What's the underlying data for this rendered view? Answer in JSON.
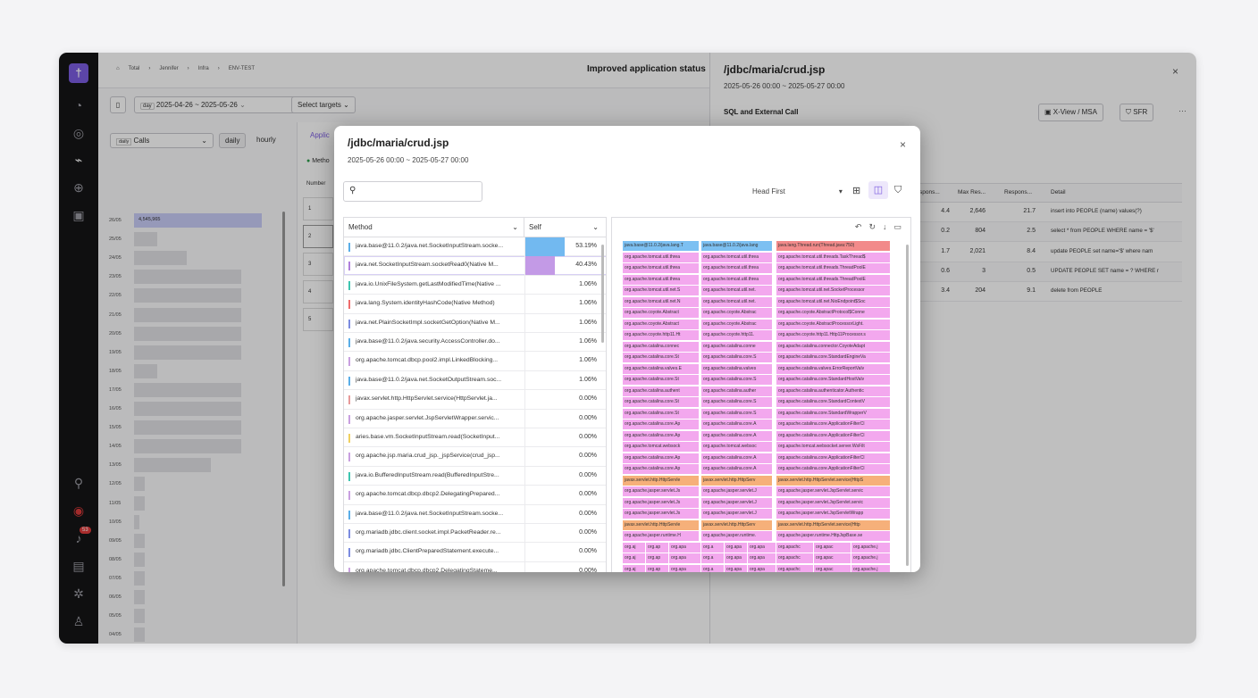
{
  "breadcrumb": [
    "Total",
    "Jennifer",
    "Infra",
    "ENV-TEST"
  ],
  "status_title": "Improved application status",
  "date_range": "2025-04-26 ~ 2025-05-26",
  "date_chip": "day",
  "select_targets": "Select targets",
  "calls_select": "Calls",
  "daily_label": "daily",
  "daily_btn": "daily",
  "hourly_btn": "hourly",
  "center_tab": "Applic",
  "center_method": "Metho",
  "center_number": "Number",
  "center_rows": [
    "1",
    "2",
    "3",
    "4",
    "5"
  ],
  "left_rows": [
    {
      "date": "26/05",
      "value": "4,545,965",
      "bar": 0.95
    },
    {
      "date": "25/05",
      "value": "",
      "bar": 0.17
    },
    {
      "date": "24/05",
      "value": "",
      "bar": 0.39
    },
    {
      "date": "23/05",
      "value": "",
      "bar": 0.8
    },
    {
      "date": "22/05",
      "value": "",
      "bar": 0.8
    },
    {
      "date": "21/05",
      "value": "",
      "bar": 0.8
    },
    {
      "date": "20/05",
      "value": "",
      "bar": 0.8
    },
    {
      "date": "19/05",
      "value": "",
      "bar": 0.8
    },
    {
      "date": "18/05",
      "value": "",
      "bar": 0.17
    },
    {
      "date": "17/05",
      "value": "",
      "bar": 0.8
    },
    {
      "date": "16/05",
      "value": "",
      "bar": 0.8
    },
    {
      "date": "15/05",
      "value": "",
      "bar": 0.8
    },
    {
      "date": "14/05",
      "value": "",
      "bar": 0.8
    },
    {
      "date": "13/05",
      "value": "",
      "bar": 0.57
    },
    {
      "date": "12/05",
      "value": "",
      "bar": 0.08
    },
    {
      "date": "11/05",
      "value": "",
      "bar": 0.08
    },
    {
      "date": "10/05",
      "value": "",
      "bar": 0.04
    },
    {
      "date": "09/05",
      "value": "",
      "bar": 0.08
    },
    {
      "date": "08/05",
      "value": "",
      "bar": 0.08
    },
    {
      "date": "07/05",
      "value": "",
      "bar": 0.08
    },
    {
      "date": "06/05",
      "value": "",
      "bar": 0.08
    },
    {
      "date": "05/05",
      "value": "",
      "bar": 0.08
    },
    {
      "date": "04/05",
      "value": "",
      "bar": 0.08
    }
  ],
  "right": {
    "title": "/jdbc/maria/crud.jsp",
    "subtitle": "2025-05-26 00:00 ~ 2025-05-27 00:00",
    "section": "SQL and External Call",
    "xview_btn": "X-View / MSA",
    "sfr_btn": "SFR",
    "more": "···",
    "close": "×",
    "headers": [
      "spons...",
      "Max Res...",
      "Respons...",
      "Detail"
    ],
    "rows": [
      [
        "4.4",
        "2,646",
        "21.7",
        "insert into PEOPLE (name) values(?)"
      ],
      [
        "0.2",
        "804",
        "2.5",
        "select * from PEOPLE WHERE name = '$'"
      ],
      [
        "1.7",
        "2,021",
        "8.4",
        "update PEOPLE set name='$' where nam"
      ],
      [
        "0.6",
        "3",
        "0.5",
        "UPDATE PEOPLE SET name = ? WHERE r"
      ],
      [
        "3.4",
        "204",
        "9.1",
        "delete from PEOPLE"
      ]
    ]
  },
  "modal": {
    "title": "/jdbc/maria/crud.jsp",
    "subtitle": "2025-05-26 00:00 ~ 2025-05-27 00:00",
    "close": "×",
    "search_placeholder": "",
    "view_mode": "Head First",
    "col_method": "Method",
    "col_self": "Self",
    "rows": [
      {
        "method": "java.base@11.0.2/java.net.SocketInputStream.socke...",
        "self": "53.19%",
        "color": "#5aaee8",
        "bar": 1.0,
        "barcolor": "#72b9f0"
      },
      {
        "method": "java.net.SocketInputStream.socketRead0(Native M...",
        "self": "40.43%",
        "color": "#b07fdc",
        "bar": 0.76,
        "barcolor": "#c39ae6"
      },
      {
        "method": "java.io.UnixFileSystem.getLastModifiedTime(Native ...",
        "self": "1.06%",
        "color": "#3ec5b0",
        "bar": 0,
        "barcolor": ""
      },
      {
        "method": "java.lang.System.identityHashCode(Native Method)",
        "self": "1.06%",
        "color": "#ef6b6b",
        "bar": 0,
        "barcolor": ""
      },
      {
        "method": "java.net.PlainSocketImpl.socketGetOption(Native M...",
        "self": "1.06%",
        "color": "#7c8ce0",
        "bar": 0,
        "barcolor": ""
      },
      {
        "method": "java.base@11.0.2/java.security.AccessController.do...",
        "self": "1.06%",
        "color": "#5aaee8",
        "bar": 0,
        "barcolor": ""
      },
      {
        "method": "org.apache.tomcat.dbcp.pool2.impl.LinkedBlocking...",
        "self": "1.06%",
        "color": "#c9a0e0",
        "bar": 0,
        "barcolor": ""
      },
      {
        "method": "java.base@11.0.2/java.net.SocketOutputStream.soc...",
        "self": "1.06%",
        "color": "#5aaee8",
        "bar": 0,
        "barcolor": ""
      },
      {
        "method": "javax.servlet.http.HttpServlet.service(HttpServlet.ja...",
        "self": "0.00%",
        "color": "#e89a9a",
        "bar": 0,
        "barcolor": ""
      },
      {
        "method": "org.apache.jasper.servlet.JspServletWrapper.servic...",
        "self": "0.00%",
        "color": "#c9a0e0",
        "bar": 0,
        "barcolor": ""
      },
      {
        "method": "aries.base.vm.SocketInputStream.read(SocketInput...",
        "self": "0.00%",
        "color": "#f0d060",
        "bar": 0,
        "barcolor": ""
      },
      {
        "method": "org.apache.jsp.maria.crud_jsp._jspService(crud_jsp...",
        "self": "0.00%",
        "color": "#c9a0e0",
        "bar": 0,
        "barcolor": ""
      },
      {
        "method": "java.io.BufferedInputStream.read(BufferedInputStre...",
        "self": "0.00%",
        "color": "#3ec5b0",
        "bar": 0,
        "barcolor": ""
      },
      {
        "method": "org.apache.tomcat.dbcp.dbcp2.DelegatingPrepared...",
        "self": "0.00%",
        "color": "#c9a0e0",
        "bar": 0,
        "barcolor": ""
      },
      {
        "method": "java.base@11.0.2/java.net.SocketInputStream.socke...",
        "self": "0.00%",
        "color": "#5aaee8",
        "bar": 0,
        "barcolor": ""
      },
      {
        "method": "org.mariadb.jdbc.client.socket.impl.PacketReader.re...",
        "self": "0.00%",
        "color": "#7c8ce0",
        "bar": 0,
        "barcolor": ""
      },
      {
        "method": "org.mariadb.jdbc.ClientPreparedStatement.execute...",
        "self": "0.00%",
        "color": "#7c8ce0",
        "bar": 0,
        "barcolor": ""
      },
      {
        "method": "org.apache.tomcat.dbcp.dbcp2.DelegatingStateme...",
        "self": "0.00%",
        "color": "#c9a0e0",
        "bar": 0,
        "barcolor": ""
      }
    ],
    "flame_rows": [
      {
        "bg": "top",
        "cells": [
          "java.base@11.0.2/java.lang.T",
          "java.base@11.0.2/java.lang",
          "java.lang.Thread.run(Thread.java:750)"
        ]
      },
      {
        "bg": "pink",
        "cells": [
          "org.apache.tomcat.util.threa",
          "org.apache.tomcat.util.threa",
          "org.apache.tomcat.util.threads.TaskThread$"
        ]
      },
      {
        "bg": "pink",
        "cells": [
          "org.apache.tomcat.util.threa",
          "org.apache.tomcat.util.threa",
          "org.apache.tomcat.util.threads.ThreadPoolE"
        ]
      },
      {
        "bg": "pink",
        "cells": [
          "org.apache.tomcat.util.threa",
          "org.apache.tomcat.util.threa",
          "org.apache.tomcat.util.threads.ThreadPoolE"
        ]
      },
      {
        "bg": "pink",
        "cells": [
          "org.apache.tomcat.util.net.S",
          "org.apache.tomcat.util.net.",
          "org.apache.tomcat.util.net.SocketProcessor"
        ]
      },
      {
        "bg": "pink",
        "cells": [
          "org.apache.tomcat.util.net.N",
          "org.apache.tomcat.util.net.",
          "org.apache.tomcat.util.net.NioEndpoint$Soc"
        ]
      },
      {
        "bg": "pink",
        "cells": [
          "org.apache.coyote.Abstract",
          "org.apache.coyote.Abstrac",
          "org.apache.coyote.AbstractProtocol$Conne"
        ]
      },
      {
        "bg": "pink",
        "cells": [
          "org.apache.coyote.Abstract",
          "org.apache.coyote.Abstrac",
          "org.apache.coyote.AbstractProcessorLight."
        ]
      },
      {
        "bg": "pink",
        "cells": [
          "org.apache.coyote.http11.Ht",
          "org.apache.coyote.http11.",
          "org.apache.coyote.http11.Http11Processor.s"
        ]
      },
      {
        "bg": "pink",
        "cells": [
          "org.apache.catalina.connec",
          "org.apache.catalina.conne",
          "org.apache.catalina.connector.CoyoteAdapt"
        ]
      },
      {
        "bg": "pink",
        "cells": [
          "org.apache.catalina.core.St",
          "org.apache.catalina.core.S",
          "org.apache.catalina.core.StandardEngineVa"
        ]
      },
      {
        "bg": "pink",
        "cells": [
          "org.apache.catalina.valves.E",
          "org.apache.catalina.valves",
          "org.apache.catalina.valves.ErrorReportValv"
        ]
      },
      {
        "bg": "pink",
        "cells": [
          "org.apache.catalina.core.St",
          "org.apache.catalina.core.S",
          "org.apache.catalina.core.StandardHostValv"
        ]
      },
      {
        "bg": "pink",
        "cells": [
          "org.apache.catalina.authent",
          "org.apache.catalina.auther",
          "org.apache.catalina.authenticator.Authentic"
        ]
      },
      {
        "bg": "pink",
        "cells": [
          "org.apache.catalina.core.St",
          "org.apache.catalina.core.S",
          "org.apache.catalina.core.StandardContextV"
        ]
      },
      {
        "bg": "pink",
        "cells": [
          "org.apache.catalina.core.St",
          "org.apache.catalina.core.S",
          "org.apache.catalina.core.StandardWrapperV"
        ]
      },
      {
        "bg": "pink",
        "cells": [
          "org.apache.catalina.core.Ap",
          "org.apache.catalina.core.A",
          "org.apache.catalina.core.ApplicationFilterCl"
        ]
      },
      {
        "bg": "pink",
        "cells": [
          "org.apache.catalina.core.Ap",
          "org.apache.catalina.core.A",
          "org.apache.catalina.core.ApplicationFilterCl"
        ]
      },
      {
        "bg": "pink",
        "cells": [
          "org.apache.tomcat.websock",
          "org.apache.tomcat.websoc",
          "org.apache.tomcat.websocket.server.WsFilt"
        ]
      },
      {
        "bg": "pink",
        "cells": [
          "org.apache.catalina.core.Ap",
          "org.apache.catalina.core.A",
          "org.apache.catalina.core.ApplicationFilterCl"
        ]
      },
      {
        "bg": "pink",
        "cells": [
          "org.apache.catalina.core.Ap",
          "org.apache.catalina.core.A",
          "org.apache.catalina.core.ApplicationFilterCl"
        ]
      },
      {
        "bg": "orange",
        "cells": [
          "javax.servlet.http.HttpServle",
          "javax.servlet.http.HttpServ",
          "javax.servlet.http.HttpServlet.service(HttpS"
        ]
      },
      {
        "bg": "pink",
        "cells": [
          "org.apache.jasper.servlet.Js",
          "org.apache.jasper.servlet.J",
          "org.apache.jasper.servlet.JspServlet.servic"
        ]
      },
      {
        "bg": "pink",
        "cells": [
          "org.apache.jasper.servlet.Js",
          "org.apache.jasper.servlet.J",
          "org.apache.jasper.servlet.JspServlet.servic"
        ]
      },
      {
        "bg": "pink",
        "cells": [
          "org.apache.jasper.servlet.Js",
          "org.apache.jasper.servlet.J",
          "org.apache.jasper.servlet.JspServletWrapp"
        ]
      },
      {
        "bg": "orange",
        "cells": [
          "javax.servlet.http.HttpServle",
          "javax.servlet.http.HttpServ",
          "javax.servlet.http.HttpServlet.service(Http"
        ]
      },
      {
        "bg": "pink",
        "cells": [
          "org.apache.jasper.runtime.H",
          "org.apache.jasper.runtime.",
          "org.apache.jasper.runtime.HttpJspBase.se"
        ]
      }
    ],
    "flame_tail": [
      "org.aj",
      "org.ap",
      "org.apa",
      "org.a",
      "org.apa",
      "org.apa",
      "org.apachc",
      "org.apac",
      "org.apache.j"
    ]
  },
  "colors": {
    "accent": "#7b5ce0",
    "rail": "#141416",
    "flame_pink": "#f3a8ee",
    "flame_orange": "#f6b07a",
    "flame_blue": "#7cc0f2",
    "flame_red": "#f28a8a"
  },
  "icons": [
    "logo-icon",
    "dashboard-icon",
    "analysis-icon",
    "topology-icon",
    "globe-icon",
    "report-icon",
    "search-icon",
    "alert-icon",
    "bell-icon",
    "chat-icon",
    "settings-icon",
    "user-icon"
  ],
  "bell_count": "53"
}
